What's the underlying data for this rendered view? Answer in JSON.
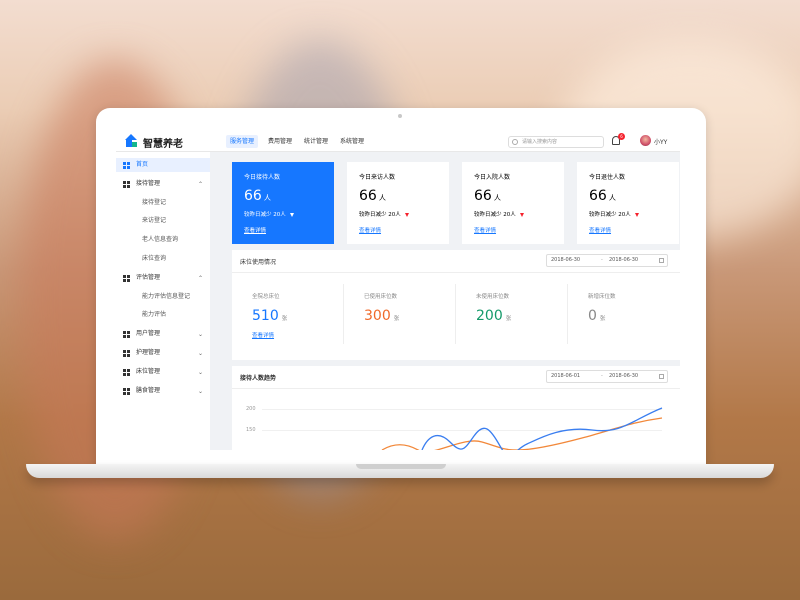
{
  "app": {
    "brand": "智慧养老"
  },
  "header": {
    "tabs": [
      "服务管理",
      "费用管理",
      "统计管理",
      "系统管理"
    ],
    "active_tab": 0,
    "search_placeholder": "请输入搜索内容",
    "notification_count": "6",
    "user_name": "小YY"
  },
  "sidebar": {
    "items": [
      {
        "label": "首页",
        "type": "top",
        "active": true
      },
      {
        "label": "接待管理",
        "type": "top",
        "chevron": "⌃"
      },
      {
        "label": "接待登记",
        "type": "sub"
      },
      {
        "label": "来访登记",
        "type": "sub"
      },
      {
        "label": "老人信息查询",
        "type": "sub"
      },
      {
        "label": "床位查询",
        "type": "sub"
      },
      {
        "label": "评估管理",
        "type": "top",
        "chevron": "⌃"
      },
      {
        "label": "能力评估信息登记",
        "type": "sub"
      },
      {
        "label": "能力评估",
        "type": "sub"
      },
      {
        "label": "用户管理",
        "type": "top",
        "chevron": "⌄"
      },
      {
        "label": "护理管理",
        "type": "top",
        "chevron": "⌄"
      },
      {
        "label": "床位管理",
        "type": "top",
        "chevron": "⌄"
      },
      {
        "label": "膳食管理",
        "type": "top",
        "chevron": "⌄"
      }
    ]
  },
  "cards": [
    {
      "title": "今日接待人数",
      "value": "66",
      "unit": "人",
      "compare": "较昨日减少 20人",
      "link": "查看详情",
      "primary": true
    },
    {
      "title": "今日来访人数",
      "value": "66",
      "unit": "人",
      "compare": "较昨日减少 20人",
      "link": "查看详情",
      "primary": false
    },
    {
      "title": "今日入院人数",
      "value": "66",
      "unit": "人",
      "compare": "较昨日减少 20人",
      "link": "查看详情",
      "primary": false
    },
    {
      "title": "今日退住人数",
      "value": "66",
      "unit": "人",
      "compare": "较昨日减少 20人",
      "link": "查看详情",
      "primary": false
    }
  ],
  "bed_usage": {
    "title": "床位使用情况",
    "date_from": "2018-06-30",
    "date_to": "2018-06-30",
    "date_separator": "-",
    "stats": [
      {
        "label": "全院总床位",
        "value": "510",
        "unit": "张",
        "color": "#1677ff",
        "link": "查看详情"
      },
      {
        "label": "已使用床位数",
        "value": "300",
        "unit": "张",
        "color": "#f06a2a",
        "link": ""
      },
      {
        "label": "未使用床位数",
        "value": "200",
        "unit": "张",
        "color": "#159a6a",
        "link": ""
      },
      {
        "label": "新增床位数",
        "value": "0",
        "unit": "张",
        "color": "#888888",
        "link": ""
      }
    ]
  },
  "reception_trend": {
    "title": "接待人数趋势",
    "date_from": "2018-06-01",
    "date_to": "2018-06-30",
    "date_separator": "-",
    "y_ticks": [
      "200",
      "150"
    ],
    "colors": {
      "blue": "#3a7ef0",
      "orange": "#f2883a"
    }
  },
  "colors": {
    "accent": "#1677ff",
    "down_indicator": "#f5222d"
  }
}
